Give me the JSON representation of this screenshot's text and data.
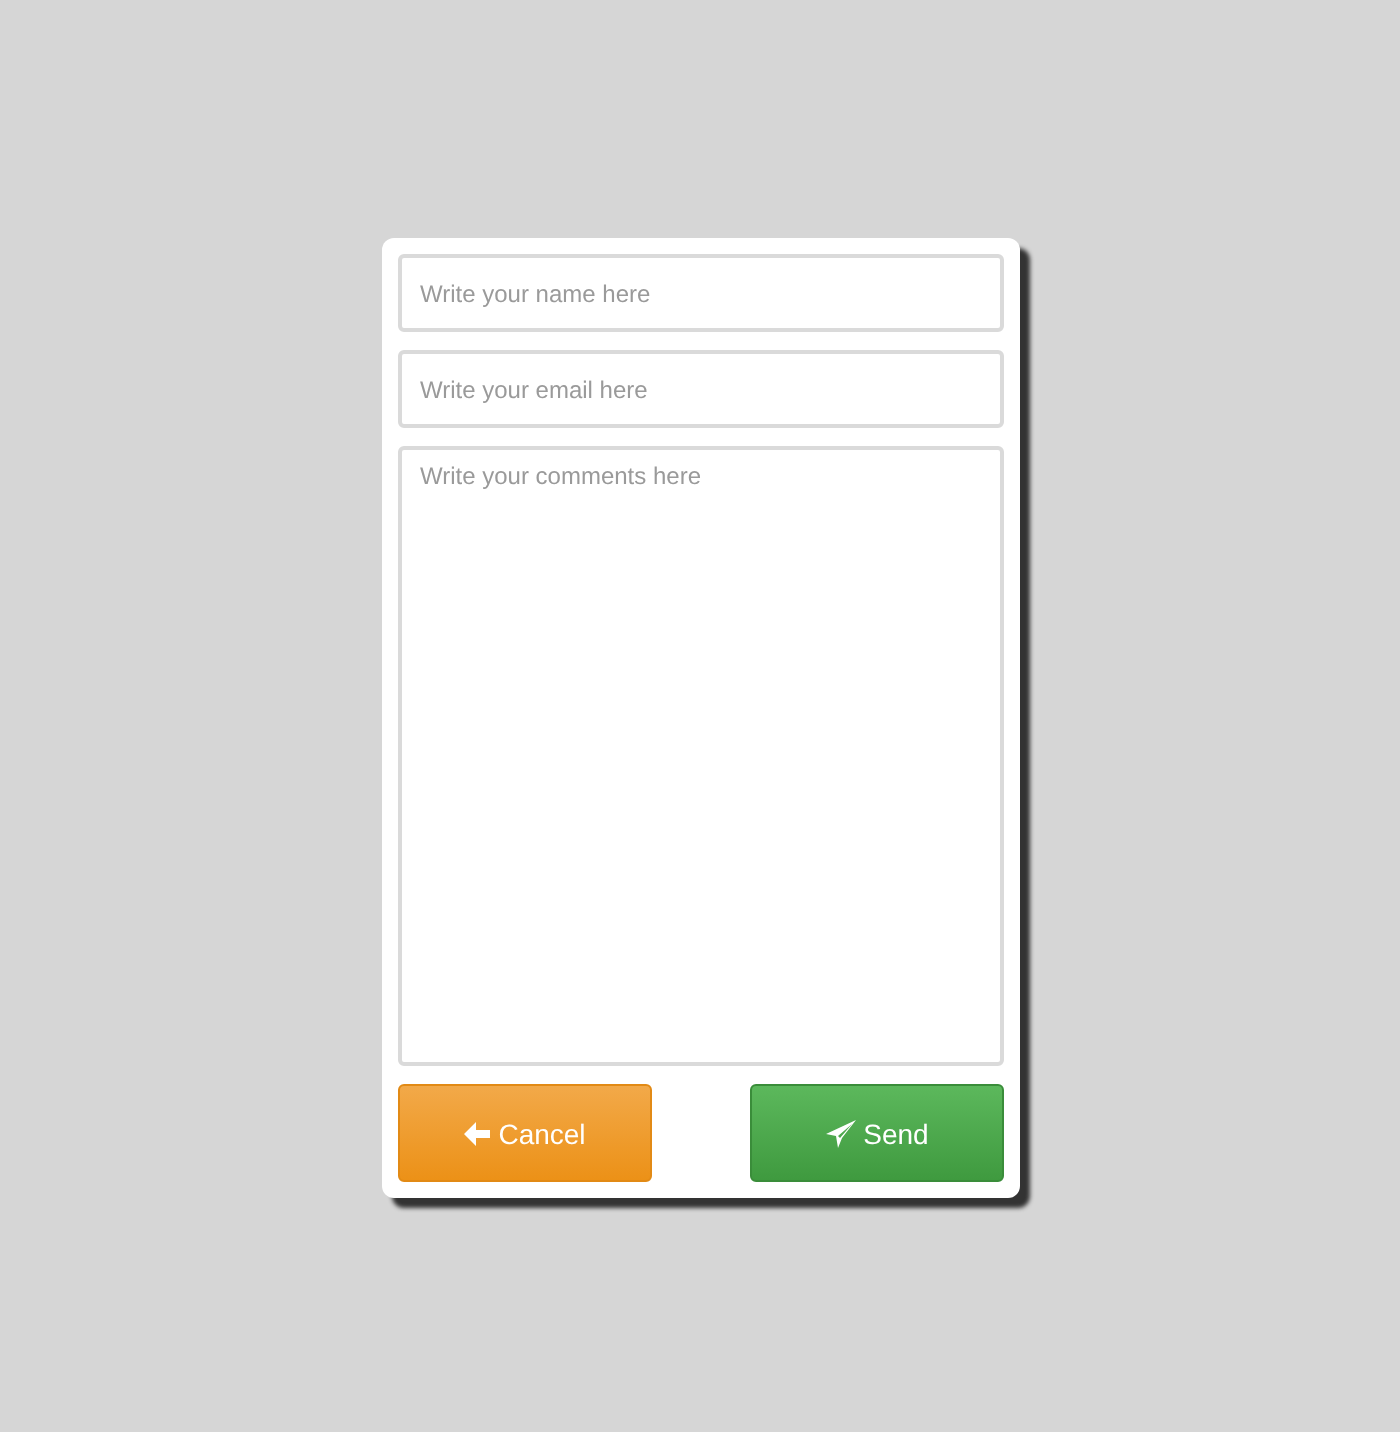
{
  "fields": [
    {
      "kind": "input",
      "placeholder": "Write your name here"
    },
    {
      "kind": "input",
      "placeholder": "Write your email here"
    },
    {
      "kind": "textarea",
      "placeholder": "Write your comments here"
    }
  ],
  "buttons": [
    {
      "kind": "cancel",
      "label": "Cancel"
    },
    {
      "kind": "send",
      "label": "Send"
    }
  ]
}
